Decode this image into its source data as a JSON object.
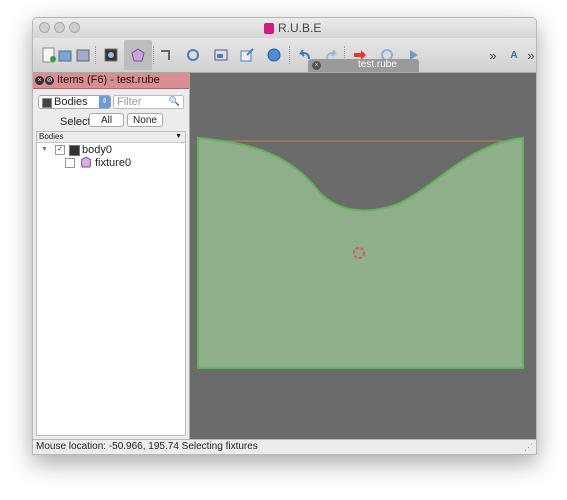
{
  "window": {
    "title": "R.U.B.E"
  },
  "panel": {
    "title": "Items (F6) - test.rube",
    "type_select": "Bodies",
    "filter_placeholder": "Filter",
    "select_label": "Select:",
    "all_button": "All",
    "none_button": "None",
    "tree_header": "Bodies",
    "tree": [
      {
        "label": "body0",
        "checked": true
      },
      {
        "label": "fixture0",
        "checked": false
      }
    ]
  },
  "editor": {
    "tab_label": "test.rube"
  },
  "status": {
    "text": "Mouse location: -50.966, 195.74  Selecting fixtures"
  },
  "colors": {
    "fixture_fill": "#8fae8a",
    "fixture_outline": "#62b35a",
    "canvas_bg": "#6b6b6b",
    "panel_header": "#d98e92",
    "brand": "#d7197c"
  },
  "toolbar_icons": [
    "new-document-icon",
    "open-icon",
    "save-icon",
    "world-icon",
    "fixture-mode-icon",
    "joint-icon",
    "vertex-icon",
    "image-icon",
    "export-icon",
    "globe-icon",
    "undo-icon",
    "redo-icon",
    "run-icon",
    "reset-icon",
    "play-icon",
    "more-icon",
    "text-icon",
    "overflow-icon"
  ]
}
